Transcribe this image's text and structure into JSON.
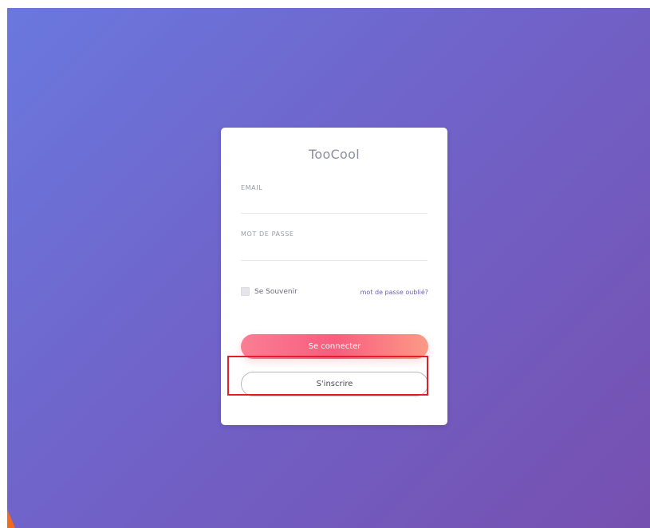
{
  "brand": {
    "title": "TooCool"
  },
  "form": {
    "email_label": "EMAIL",
    "email_value": "",
    "password_label": "MOT DE PASSE",
    "password_value": "",
    "remember_label": "Se Souvenir",
    "remember_checked": false,
    "forgot_link": "mot de passe oublié?",
    "login_button": "Se connecter",
    "signup_button": "S'inscrire"
  },
  "colors": {
    "background_start": "#6a78de",
    "background_end": "#7650b0",
    "login_gradient_start": "#fa7e93",
    "login_gradient_end": "#fc9a86",
    "link": "#6a63b8",
    "highlight": "#e01f26",
    "corner_accent": "#f26a1e"
  }
}
